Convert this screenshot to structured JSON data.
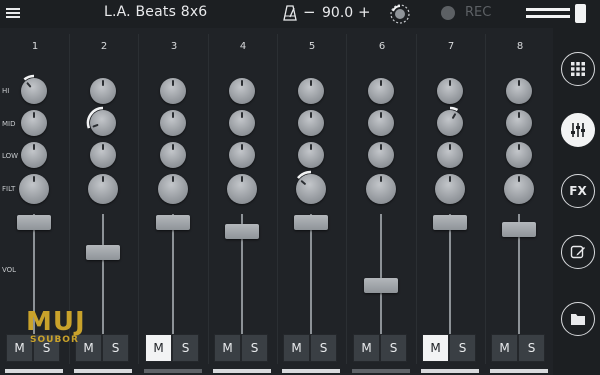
{
  "header": {
    "title": "L.A. Beats 8x6",
    "tempo_minus": "−",
    "tempo_value": "90.0",
    "tempo_plus": "+",
    "rec_label": "REC"
  },
  "row_labels": {
    "hi": "HI",
    "mid": "MID",
    "low": "LOW",
    "filt": "FILT",
    "vol": "VOL"
  },
  "channels": [
    {
      "number": "1",
      "fader_level": 0.95,
      "mute": "M",
      "solo": "S",
      "muted": false
    },
    {
      "number": "2",
      "fader_level": 0.65,
      "mute": "M",
      "solo": "S",
      "muted": false
    },
    {
      "number": "3",
      "fader_level": 0.95,
      "mute": "M",
      "solo": "S",
      "muted": true
    },
    {
      "number": "4",
      "fader_level": 0.86,
      "mute": "M",
      "solo": "S",
      "muted": false
    },
    {
      "number": "5",
      "fader_level": 0.95,
      "mute": "M",
      "solo": "S",
      "muted": false
    },
    {
      "number": "6",
      "fader_level": 0.32,
      "mute": "M",
      "solo": "S",
      "muted": false
    },
    {
      "number": "7",
      "fader_level": 0.95,
      "mute": "M",
      "solo": "S",
      "muted": true
    },
    {
      "number": "8",
      "fader_level": 0.88,
      "mute": "M",
      "solo": "S",
      "muted": false
    }
  ],
  "right_panel": {
    "fx_label": "FX"
  },
  "watermark": {
    "main": "MUJ",
    "sub": "SOUBOR"
  },
  "colors": {
    "background": "#202327",
    "active_button": "#f2f3f4",
    "watermark": "#c9a22b"
  }
}
